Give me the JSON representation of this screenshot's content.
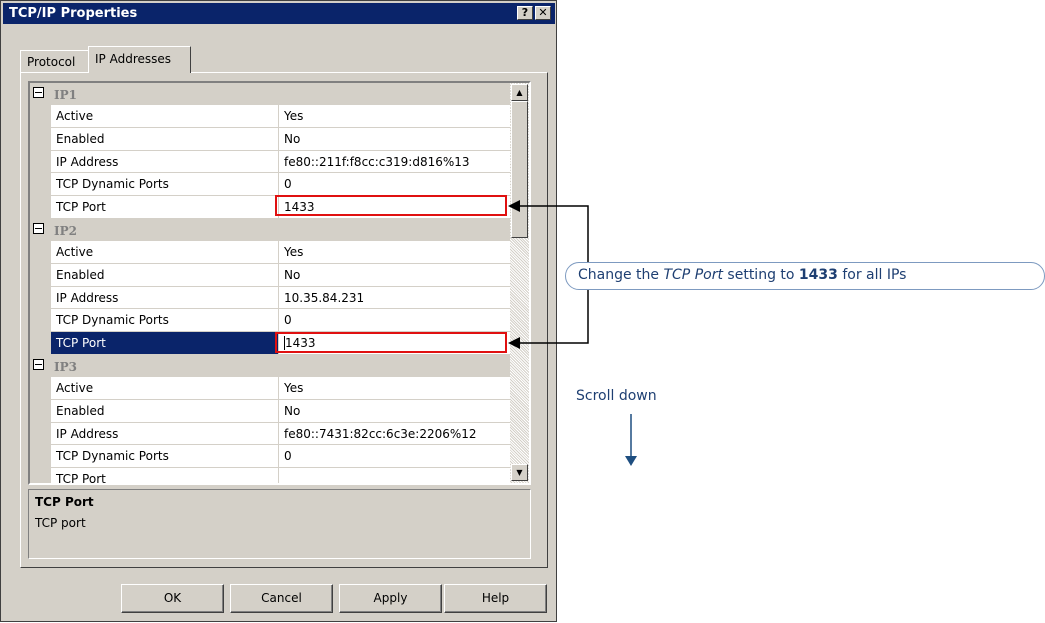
{
  "window": {
    "title": "TCP/IP Properties",
    "help_glyph": "?",
    "close_glyph": "✕"
  },
  "tabs": [
    {
      "label": "Protocol"
    },
    {
      "label": "IP Addresses",
      "active": true
    }
  ],
  "property_grid": {
    "groups": [
      {
        "name": "IP1",
        "rows": [
          {
            "name": "Active",
            "value": "Yes"
          },
          {
            "name": "Enabled",
            "value": "No"
          },
          {
            "name": "IP Address",
            "value": "fe80::211f:f8cc:c319:d816%13"
          },
          {
            "name": "TCP Dynamic Ports",
            "value": "0"
          },
          {
            "name": "TCP Port",
            "value": "1433"
          }
        ]
      },
      {
        "name": "IP2",
        "rows": [
          {
            "name": "Active",
            "value": "Yes"
          },
          {
            "name": "Enabled",
            "value": "No"
          },
          {
            "name": "IP Address",
            "value": "10.35.84.231"
          },
          {
            "name": "TCP Dynamic Ports",
            "value": "0"
          },
          {
            "name": "TCP Port",
            "value": "1433",
            "selected": true
          }
        ]
      },
      {
        "name": "IP3",
        "rows": [
          {
            "name": "Active",
            "value": "Yes"
          },
          {
            "name": "Enabled",
            "value": "No"
          },
          {
            "name": "IP Address",
            "value": "fe80::7431:82cc:6c3e:2206%12"
          },
          {
            "name": "TCP Dynamic Ports",
            "value": "0"
          },
          {
            "name": "TCP Port",
            "value": ""
          }
        ]
      }
    ]
  },
  "description": {
    "title": "TCP Port",
    "text": "TCP port"
  },
  "buttons": {
    "ok": "OK",
    "cancel": "Cancel",
    "apply": "Apply",
    "help": "Help"
  },
  "annotations": {
    "callout": {
      "prefix": "Change the ",
      "em": "TCP Port",
      "middle": " setting to ",
      "bold": "1433",
      "suffix": " for all IPs"
    },
    "scroll_label": "Scroll down"
  },
  "colors": {
    "selection": "#0a246a",
    "highlight_box": "#e01010",
    "annotation_text": "#1e3f72",
    "annotation_arrow": "#1e4e80"
  }
}
